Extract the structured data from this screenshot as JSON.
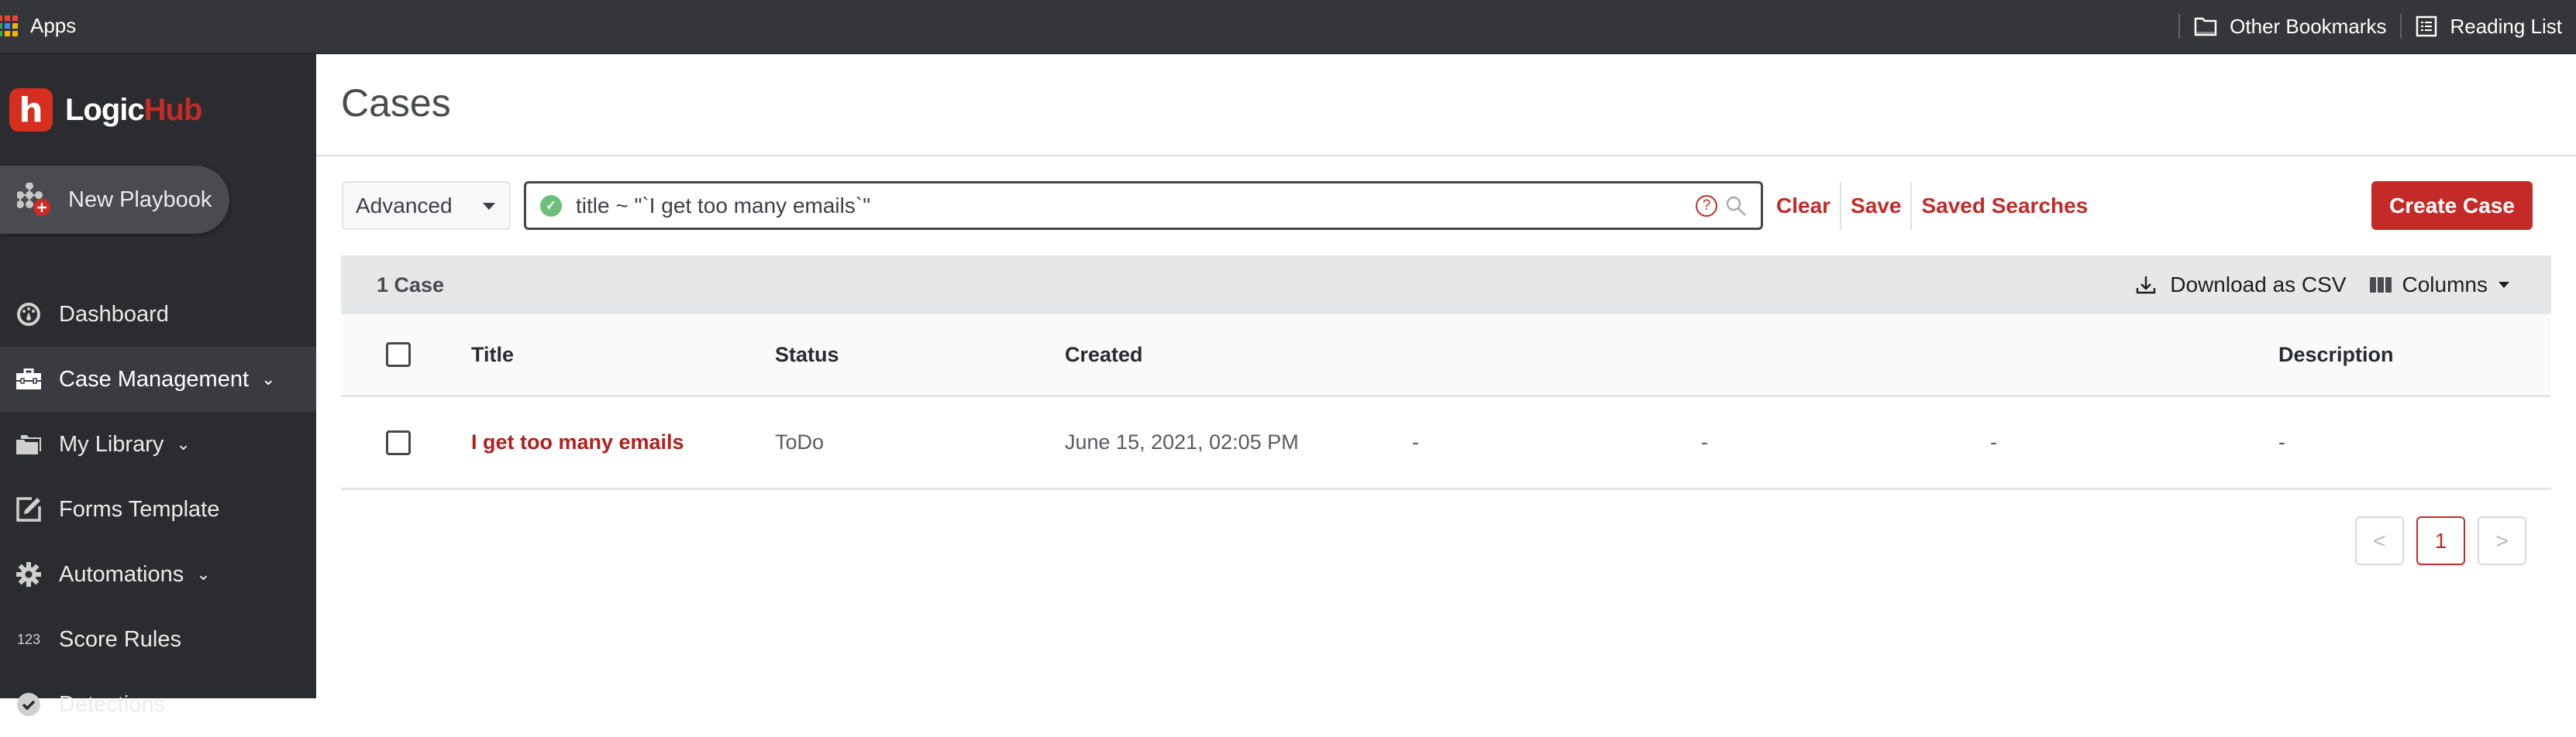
{
  "browser_bar": {
    "apps_label": "Apps",
    "other_bookmarks_label": "Other Bookmarks",
    "reading_list_label": "Reading List",
    "apps_grid_colors": [
      "#e94235",
      "#e94235",
      "#e94235",
      "#34a853",
      "#4285f4",
      "#f4b400",
      "#34a853",
      "#f4b400",
      "#f4b400"
    ]
  },
  "sidebar": {
    "logo": {
      "mark": "h",
      "text_part1": "Logic",
      "text_part2": "Hub"
    },
    "new_playbook_label": "New Playbook",
    "items": [
      {
        "label": "Dashboard",
        "icon": "dashboard-gauge-icon",
        "has_chevron": false,
        "active": false
      },
      {
        "label": "Case Management",
        "icon": "briefcase-icon",
        "has_chevron": true,
        "active": true
      },
      {
        "label": "My Library",
        "icon": "folders-icon",
        "has_chevron": true,
        "active": false
      },
      {
        "label": "Forms Template",
        "icon": "edit-form-icon",
        "has_chevron": false,
        "active": false
      },
      {
        "label": "Automations",
        "icon": "gear-icon",
        "has_chevron": true,
        "active": false
      },
      {
        "label": "Score Rules",
        "icon": "123-icon",
        "icon_text": "123",
        "has_chevron": false,
        "active": false
      },
      {
        "label": "Detections",
        "icon": "check-badge-icon",
        "has_chevron": false,
        "active": false
      }
    ],
    "chevron_glyph": "⌄"
  },
  "main": {
    "page_title": "Cases",
    "search_mode": "Advanced",
    "search_query": "title ~ \"`I get too many emails`\"",
    "links": {
      "clear": "Clear",
      "save": "Save",
      "saved_searches": "Saved Searches"
    },
    "create_button": "Create Case",
    "summary": {
      "count_label": "1 Case",
      "download_label": "Download as CSV",
      "columns_label": "Columns"
    },
    "table": {
      "headers": [
        "Title",
        "Status",
        "Created",
        "",
        "",
        "",
        "Description"
      ],
      "rows": [
        {
          "title": "I get too many emails",
          "status": "ToDo",
          "created": "June 15, 2021, 02:05 PM",
          "col4": "-",
          "col5": "-",
          "col6": "-",
          "description": "-"
        }
      ]
    },
    "pagination": {
      "prev": "<",
      "current_page": "1",
      "next": ">"
    }
  },
  "colors": {
    "brand_red": "#c42b28",
    "sidebar_bg": "#2b2c30",
    "browser_bar_bg": "#35363a",
    "success_green": "#6cbf7a"
  }
}
